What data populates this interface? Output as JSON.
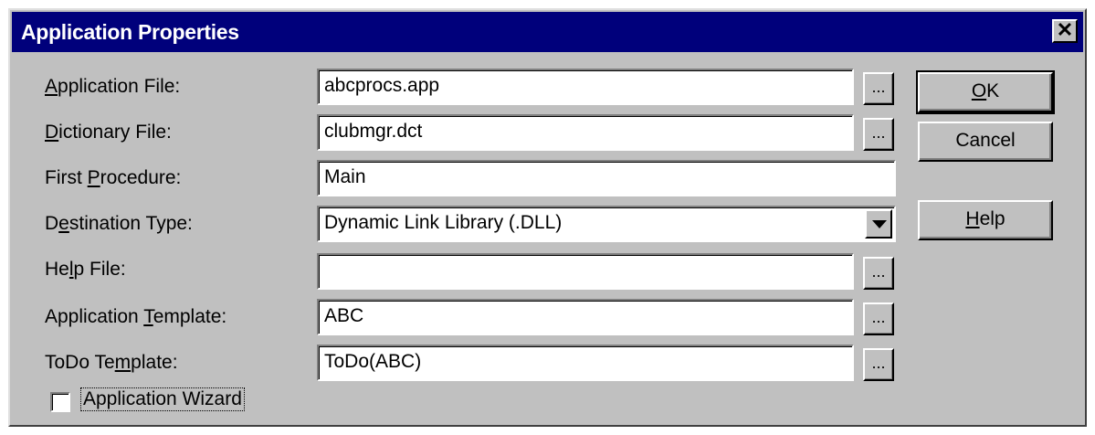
{
  "window": {
    "title": "Application Properties",
    "close_glyph": "✕"
  },
  "fields": [
    {
      "label_pre": "",
      "label_key": "A",
      "label_post": "pplication File:",
      "value": "abcprocs.app",
      "has_browse": true
    },
    {
      "label_pre": "",
      "label_key": "D",
      "label_post": "ictionary File:",
      "value": "clubmgr.dct",
      "has_browse": true
    },
    {
      "label_pre": "First ",
      "label_key": "P",
      "label_post": "rocedure:",
      "value": "Main",
      "has_browse": false
    },
    {
      "label_pre": "D",
      "label_key": "e",
      "label_post": "stination Type:",
      "value": "Dynamic Link Library (.DLL)",
      "has_browse": false
    },
    {
      "label_pre": "He",
      "label_key": "l",
      "label_post": "p File:",
      "value": "",
      "has_browse": true
    },
    {
      "label_pre": "Application ",
      "label_key": "T",
      "label_post": "emplate:",
      "value": "ABC",
      "has_browse": true
    },
    {
      "label_pre": "ToDo Te",
      "label_key": "m",
      "label_post": "plate:",
      "value": "ToDo(ABC)",
      "has_browse": true
    }
  ],
  "browse_label": "...",
  "buttons": {
    "ok": {
      "key": "O",
      "rest": "K"
    },
    "cancel": {
      "label": "Cancel"
    },
    "help": {
      "key": "H",
      "rest": "elp"
    }
  },
  "checkbox": {
    "label": "Application Wizard",
    "checked": false
  },
  "colors": {
    "titlebar": "#00007b",
    "dialog_bg": "#c0c0c0"
  }
}
